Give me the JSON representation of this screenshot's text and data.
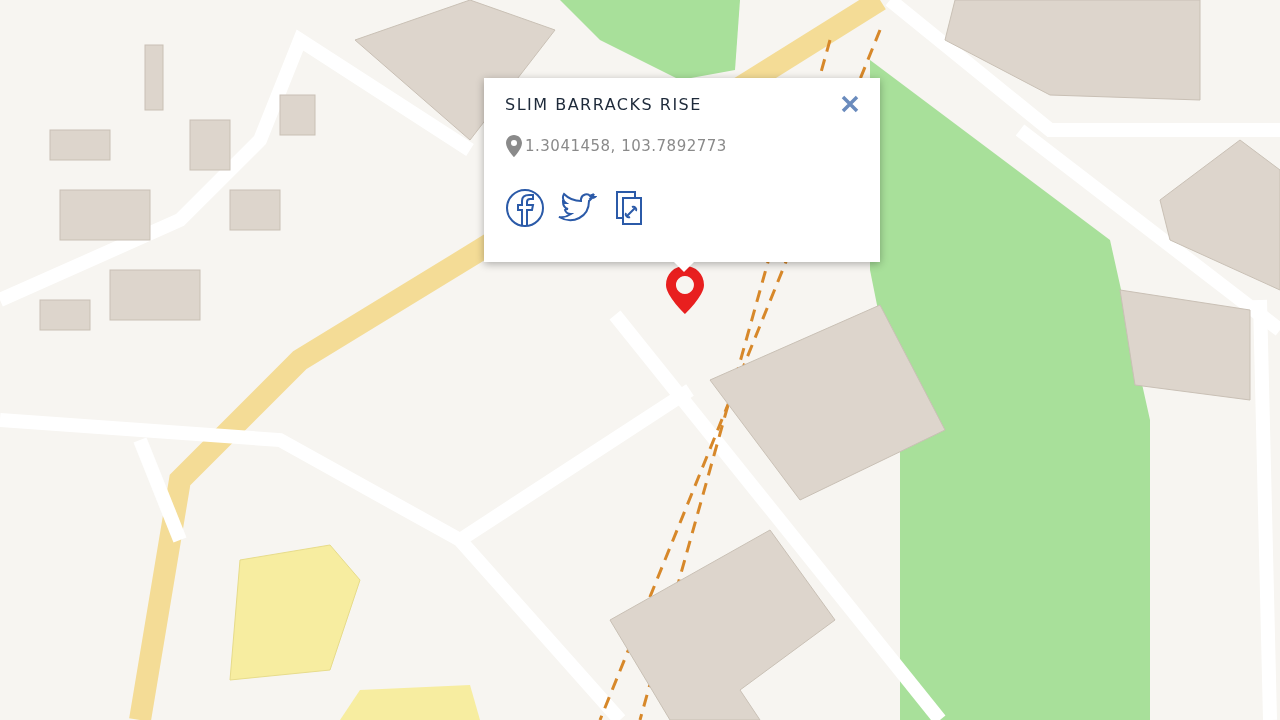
{
  "popup": {
    "title": "SLIM BARRACKS RISE",
    "coordinates": "1.3041458, 103.7892773",
    "share_buttons": [
      {
        "kind": "facebook"
      },
      {
        "kind": "twitter"
      },
      {
        "kind": "copy-link"
      }
    ]
  }
}
